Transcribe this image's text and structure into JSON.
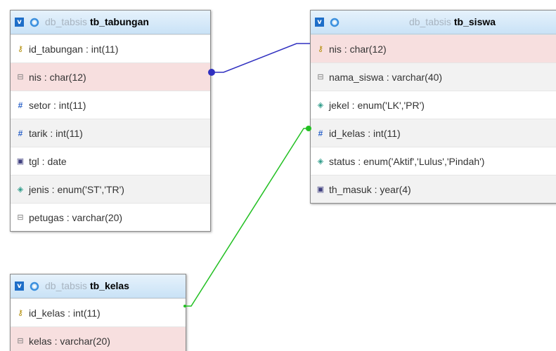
{
  "colors": {
    "relation_tabungan_siswa": "#3030c0",
    "relation_kelas_siswa": "#22c022",
    "header_accent": "#1e6ec8"
  },
  "tables": [
    {
      "db": "db_tabsis",
      "name": "tb_tabungan",
      "toggle": "v",
      "columns": [
        {
          "text": "id_tabungan : int(11)",
          "icon": "key-icon",
          "icon_glyph": "⚷"
        },
        {
          "text": "nis : char(12)",
          "icon": "text-column-icon",
          "icon_glyph": "⊟"
        },
        {
          "text": "setor : int(11)",
          "icon": "numeric-column-icon",
          "icon_glyph": "#"
        },
        {
          "text": "tarik : int(11)",
          "icon": "numeric-column-icon",
          "icon_glyph": "#"
        },
        {
          "text": "tgl : date",
          "icon": "date-column-icon",
          "icon_glyph": "▣"
        },
        {
          "text": "jenis : enum('ST','TR')",
          "icon": "enum-column-icon",
          "icon_glyph": "◈"
        },
        {
          "text": "petugas : varchar(20)",
          "icon": "text-column-icon",
          "icon_glyph": "⊟"
        }
      ]
    },
    {
      "db": "db_tabsis",
      "name": "tb_siswa",
      "toggle": "v",
      "columns": [
        {
          "text": "nis : char(12)",
          "icon": "key-icon",
          "icon_glyph": "⚷"
        },
        {
          "text": "nama_siswa : varchar(40)",
          "icon": "text-column-icon",
          "icon_glyph": "⊟"
        },
        {
          "text": "jekel : enum('LK','PR')",
          "icon": "enum-column-icon",
          "icon_glyph": "◈"
        },
        {
          "text": "id_kelas : int(11)",
          "icon": "numeric-column-icon",
          "icon_glyph": "#"
        },
        {
          "text": "status : enum('Aktif','Lulus','Pindah')",
          "icon": "enum-column-icon",
          "icon_glyph": "◈"
        },
        {
          "text": "th_masuk : year(4)",
          "icon": "date-column-icon",
          "icon_glyph": "▣"
        }
      ]
    },
    {
      "db": "db_tabsis",
      "name": "tb_kelas",
      "toggle": "v",
      "columns": [
        {
          "text": "id_kelas : int(11)",
          "icon": "key-icon",
          "icon_glyph": "⚷"
        },
        {
          "text": "kelas : varchar(20)",
          "icon": "text-column-icon",
          "icon_glyph": "⊟"
        }
      ]
    }
  ]
}
